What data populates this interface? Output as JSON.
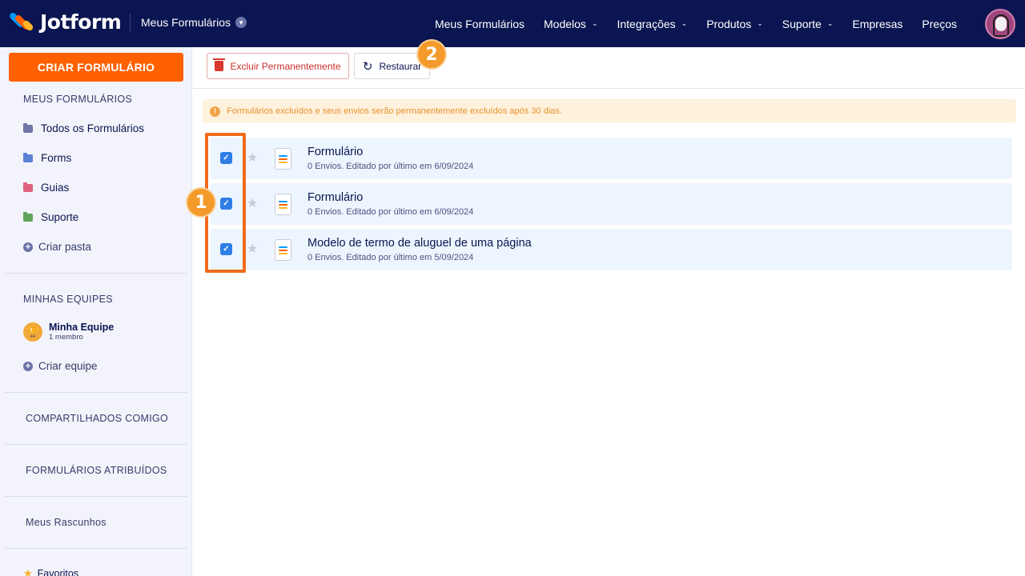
{
  "brand": {
    "name": "Jotform"
  },
  "header": {
    "app_dropdown": "Meus Formulários",
    "nav": [
      {
        "label": "Meus Formulários",
        "has_dropdown": false
      },
      {
        "label": "Modelos",
        "has_dropdown": true
      },
      {
        "label": "Integrações",
        "has_dropdown": true
      },
      {
        "label": "Produtos",
        "has_dropdown": true
      },
      {
        "label": "Suporte",
        "has_dropdown": true
      },
      {
        "label": "Empresas",
        "has_dropdown": false
      },
      {
        "label": "Preços",
        "has_dropdown": false
      }
    ]
  },
  "sidebar": {
    "create_button": "CRIAR FORMULÁRIO",
    "my_forms_title": "MEUS FORMULÁRIOS",
    "folders": [
      {
        "label": "Todos os Formulários",
        "color": "#6f76a7"
      },
      {
        "label": "Forms",
        "color": "#5d7fd6"
      },
      {
        "label": "Guias",
        "color": "#e0607e"
      },
      {
        "label": "Suporte",
        "color": "#5fa55a"
      }
    ],
    "create_folder": "Criar pasta",
    "teams_title": "MINHAS EQUIPES",
    "team": {
      "name": "Minha Equipe",
      "members": "1 membro"
    },
    "create_team": "Criar equipe",
    "shared_with_me": "COMPARTILHADOS COMIGO",
    "assigned_forms": "FORMULÁRIOS ATRIBUÍDOS",
    "drafts": "Meus Rascunhos",
    "favorites": "Favoritos"
  },
  "toolbar": {
    "delete_label": "Excluir Permanentemente",
    "restore_label": "Restaurar"
  },
  "warning": {
    "icon_text": "!",
    "text": "Formulários excluídos e seus envios serão permanentemente excluídos após 30 dias."
  },
  "forms": [
    {
      "title": "Formulário",
      "subtitle": "0 Envios. Editado por último em 6/09/2024",
      "checked": true
    },
    {
      "title": "Formulário",
      "subtitle": "0 Envios. Editado por último em 6/09/2024",
      "checked": true
    },
    {
      "title": "Modelo de termo de aluguel de uma página",
      "subtitle": "0 Envios. Editado por último em 5/09/2024",
      "checked": true
    }
  ],
  "annotations": {
    "badge_1": "1",
    "badge_2": "2"
  },
  "colors": {
    "header_bg": "#0a1551",
    "primary_orange": "#ff6100",
    "checkbox_blue": "#2f7ee6",
    "annotation_orange": "#f26b1d"
  }
}
